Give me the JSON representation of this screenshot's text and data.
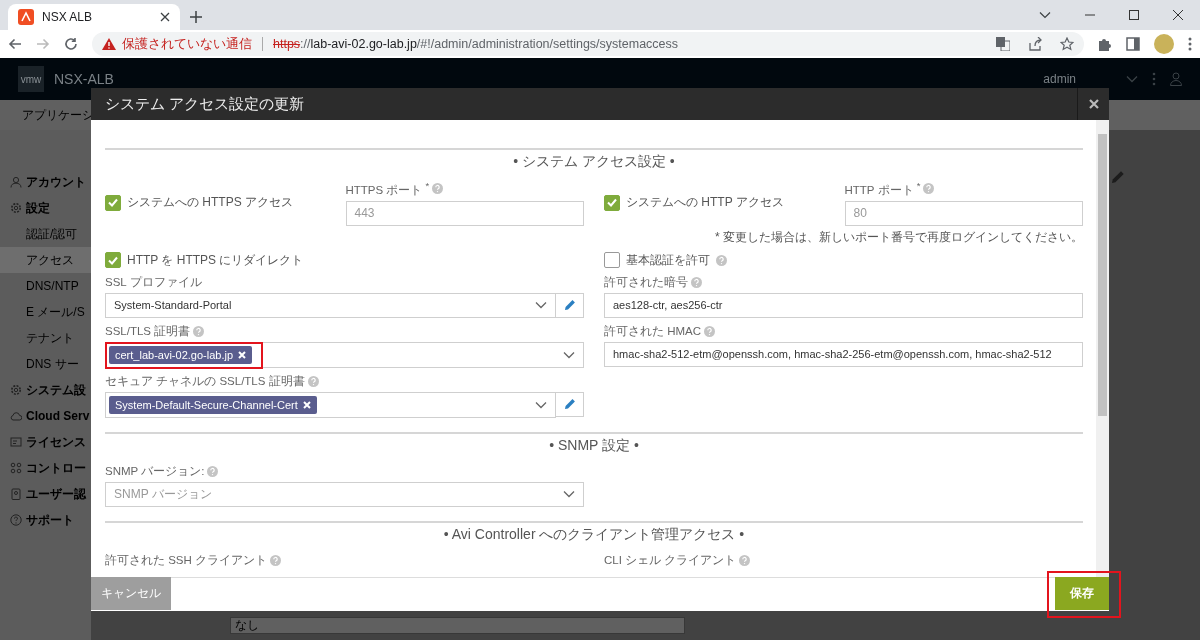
{
  "browser": {
    "tab": {
      "title": "NSX ALB",
      "selected": true
    },
    "security_warning": "保護されていない通信",
    "url": {
      "scheme": "https",
      "separator": "://",
      "host": "lab-avi-02.go-lab.jp",
      "path": "/#!/admin/administration/settings/systemaccess"
    }
  },
  "app": {
    "logo": "vmw",
    "product": "NSX-ALB",
    "user": "admin",
    "nav_item": "アプリケーシ",
    "sidebar": [
      {
        "label": "アカウント",
        "selected": false
      },
      {
        "label": "設定",
        "selected": false,
        "children": [
          {
            "label": "認証/認可",
            "selected": false
          },
          {
            "label": "アクセス",
            "selected": true
          },
          {
            "label": "DNS/NTP",
            "selected": false
          },
          {
            "label": "E メール/S",
            "selected": false
          },
          {
            "label": "テナント",
            "selected": false
          },
          {
            "label": "DNS サー",
            "selected": false
          }
        ]
      },
      {
        "label": "システム設",
        "selected": false
      },
      {
        "label": "Cloud Serv",
        "selected": false
      },
      {
        "label": "ライセンス",
        "selected": false
      },
      {
        "label": "コントロー",
        "selected": false
      },
      {
        "label": "ユーザー認",
        "selected": false
      },
      {
        "label": "サポート",
        "selected": false
      }
    ],
    "background_field": "なし"
  },
  "dialog": {
    "title": "システム アクセス設定の更新",
    "sections": [
      {
        "title": "• システム アクセス設定 •",
        "rows": [
          {
            "left": [
              {
                "kind": "checkbox",
                "label": "システムへの HTTPS アクセス",
                "checked": true
              },
              {
                "kind": "input",
                "label": "HTTPS ポート $^{*}$",
                "help": true,
                "value": "443",
                "disabled": true
              }
            ],
            "right": [
              {
                "kind": "checkbox",
                "label": "システムへの HTTP アクセス",
                "checked": true
              },
              {
                "kind": "input",
                "label": "HTTP ポート $^{*}$",
                "help": true,
                "value": "80",
                "disabled": true
              }
            ]
          },
          {
            "right": [
              {
                "kind": "note",
                "text": "* 変更した場合は、新しいポート番号で再度ログインしてください。"
              }
            ]
          },
          {
            "left": [
              {
                "kind": "checkbox",
                "label": "HTTP を HTTPS にリダイレクト",
                "checked": true
              }
            ],
            "right": [
              {
                "kind": "checkbox",
                "label": "基本認証を許可",
                "checked": false,
                "help": true
              }
            ]
          },
          {
            "left": [
              {
                "kind": "select",
                "label": "SSL プロファイル",
                "value": "System-Standard-Portal",
                "edit": true
              }
            ],
            "right": [
              {
                "kind": "input",
                "label": "許可された暗号",
                "help": true,
                "value": "aes128-ctr, aes256-ctr"
              }
            ]
          },
          {
            "left": [
              {
                "kind": "multiselect",
                "label": "SSL/TLS 証明書",
                "help": true,
                "tags": [
                  {
                    "text": "cert_lab-avi-02.go-lab.jp",
                    "highlighted": true
                  }
                ]
              }
            ],
            "right": [
              {
                "kind": "input",
                "label": "許可された HMAC",
                "help": true,
                "value": "hmac-sha2-512-etm@openssh.com, hmac-sha2-256-etm@openssh.com, hmac-sha2-512"
              }
            ]
          },
          {
            "left": [
              {
                "kind": "multiselect",
                "label": "セキュア チャネルの SSL/TLS 証明書",
                "help": true,
                "edit": true,
                "tags": [
                  {
                    "text": "System-Default-Secure-Channel-Cert",
                    "highlighted": false
                  }
                ]
              }
            ]
          }
        ]
      },
      {
        "title": "• SNMP 設定 •",
        "rows": [
          {
            "left": [
              {
                "kind": "select",
                "label": "SNMP バージョン:",
                "help": true,
                "placeholder": "SNMP バージョン"
              }
            ]
          }
        ]
      },
      {
        "title": "• Avi Controller へのクライアント管理アクセス •",
        "rows": [
          {
            "left": [
              {
                "kind": "label",
                "label": "許可された SSH クライアント",
                "help": true
              }
            ],
            "right": [
              {
                "kind": "label",
                "label": "CLI シェル クライアント",
                "help": true
              }
            ]
          }
        ]
      }
    ],
    "buttons": [
      {
        "label": "キャンセル",
        "kind": "secondary",
        "highlighted": false
      },
      {
        "label": "保存",
        "kind": "primary",
        "highlighted": true
      }
    ]
  }
}
